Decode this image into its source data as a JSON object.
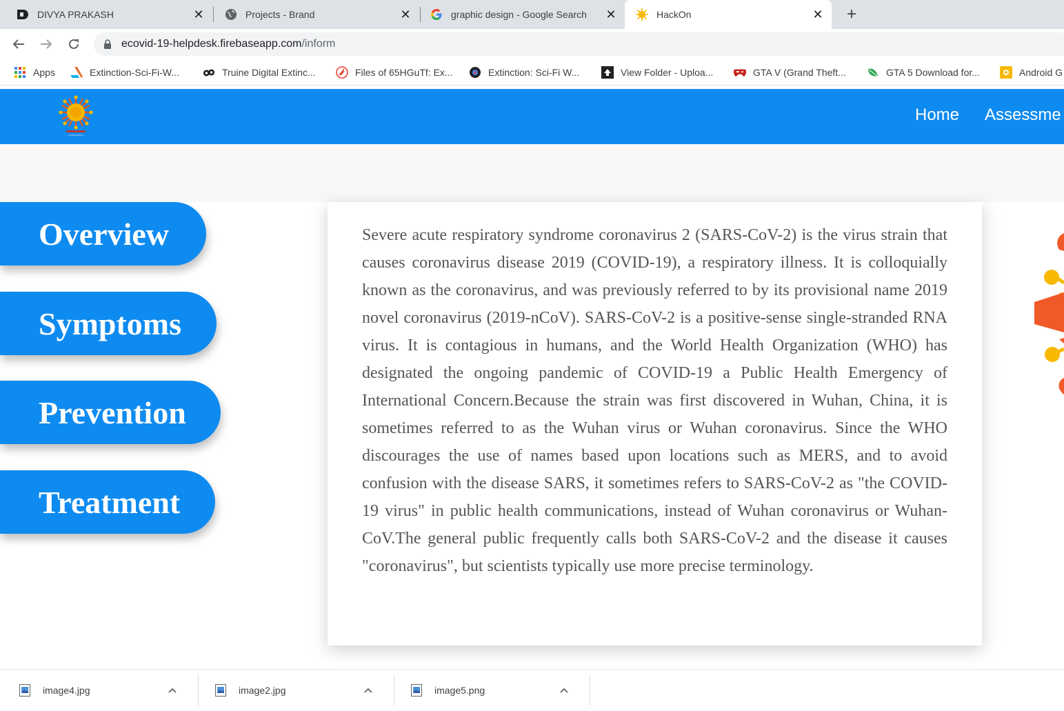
{
  "browser": {
    "tabs": [
      {
        "title": "DIVYA PRAKASH",
        "icon": "d-logo-icon"
      },
      {
        "title": "Projects - Brand",
        "icon": "globe-icon"
      },
      {
        "title": "graphic design - Google Search",
        "icon": "google-icon"
      },
      {
        "title": "HackOn",
        "icon": "virus-favicon-icon",
        "active": true
      }
    ],
    "close_glyph": "✕",
    "new_tab_glyph": "+",
    "url": {
      "domain": "ecovid-19-helpdesk.firebaseapp.com",
      "path": "/inform"
    },
    "bookmarks": [
      {
        "label": "Apps",
        "icon": "apps-grid-icon"
      },
      {
        "label": "Extinction-Sci-Fi-W...",
        "icon": "artstation-icon"
      },
      {
        "label": "Truine Digital Extinc...",
        "icon": "dp-logo-icon"
      },
      {
        "label": "Files of 65HGuTf: Ex...",
        "icon": "files-icon"
      },
      {
        "label": "Extinction: Sci-Fi W...",
        "icon": "eye-icon"
      },
      {
        "label": "View Folder - Uploa...",
        "icon": "upload-folder-icon"
      },
      {
        "label": "GTA V (Grand Theft...",
        "icon": "gamepad-icon"
      },
      {
        "label": "GTA 5 Download for...",
        "icon": "leaf-icon"
      },
      {
        "label": "Android G",
        "icon": "android-icon"
      }
    ]
  },
  "site": {
    "nav": {
      "home": "Home",
      "assessment": "Assessme"
    },
    "sections": [
      "Overview",
      "Symptoms",
      "Prevention",
      "Treatment"
    ],
    "body_text": "Severe acute respiratory syndrome coronavirus 2 (SARS-CoV-2) is the virus strain that causes coronavirus disease 2019 (COVID-19), a respiratory illness. It is colloquially known as the coronavirus, and was previously referred to by its provisional name 2019 novel coronavirus (2019-nCoV). SARS-CoV-2 is a positive-sense single-stranded RNA virus. It is contagious in humans, and the World Health Organization (WHO) has designated the ongoing pandemic of COVID-19 a Public Health Emergency of International Concern.Because the strain was first discovered in Wuhan, China, it is sometimes referred to as the Wuhan virus or Wuhan coronavirus. Since the WHO discourages the use of names based upon locations such as MERS, and to avoid confusion with the disease SARS, it sometimes refers to SARS-CoV-2 as \"the COVID-19 virus\" in public health communications, instead of Wuhan coronavirus or Wuhan-CoV.The general public frequently calls both SARS-CoV-2 and the disease it causes \"coronavirus\", but scientists typically use more precise terminology.",
    "colors": {
      "primary": "#0e8bf0",
      "virus_orange": "#f05a28",
      "virus_yellow": "#f7b800"
    }
  },
  "downloads": [
    {
      "name": "image4.jpg"
    },
    {
      "name": "image2.jpg"
    },
    {
      "name": "image5.png"
    }
  ]
}
